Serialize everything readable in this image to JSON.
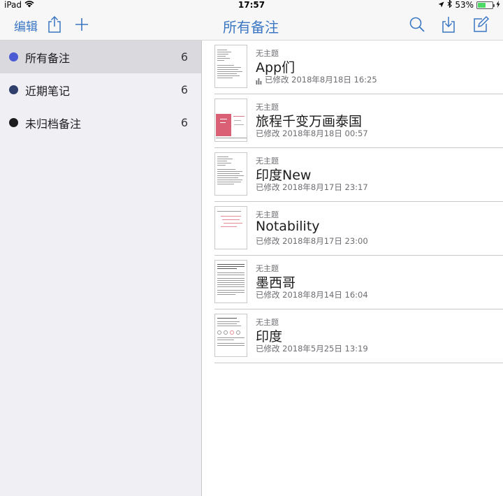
{
  "status_bar": {
    "device": "iPad",
    "time": "17:57",
    "battery": "53%",
    "battery_level": 0.53
  },
  "nav": {
    "edit_label": "编辑",
    "title": "所有备注"
  },
  "sidebar": {
    "items": [
      {
        "label": "所有备注",
        "count": "6",
        "color": "#4a5bd4",
        "selected": true
      },
      {
        "label": "近期笔记",
        "count": "6",
        "color": "#2f3e6b",
        "selected": false
      },
      {
        "label": "未归档备注",
        "count": "6",
        "color": "#1c1c1e",
        "selected": false
      }
    ]
  },
  "notes": [
    {
      "subject": "无主题",
      "name": "App们",
      "modified": "已修改 2018年8月18日 16:25",
      "has_audio": true,
      "thumb": "text-document"
    },
    {
      "subject": "无主题",
      "name": "旅程千变万画泰国",
      "modified": "已修改 2018年8月18日 00:57",
      "has_audio": false,
      "thumb": "pink-cover"
    },
    {
      "subject": "无主题",
      "name": "印度New",
      "modified": "已修改 2018年8月17日 23:17",
      "has_audio": false,
      "thumb": "text-document"
    },
    {
      "subject": "无主题",
      "name": "Notability",
      "modified": "已修改 2018年8月17日 23:00",
      "has_audio": false,
      "thumb": "handwriting"
    },
    {
      "subject": "无主题",
      "name": "墨西哥",
      "modified": "已修改 2018年8月14日 16:04",
      "has_audio": false,
      "thumb": "dense-text"
    },
    {
      "subject": "无主题",
      "name": "印度",
      "modified": "已修改 2018年5月25日 13:19",
      "has_audio": false,
      "thumb": "diagram"
    }
  ],
  "colors": {
    "accent": "#3b77c4",
    "sidebar_bg": "#efeff4",
    "selected_bg": "#d9d9de"
  }
}
